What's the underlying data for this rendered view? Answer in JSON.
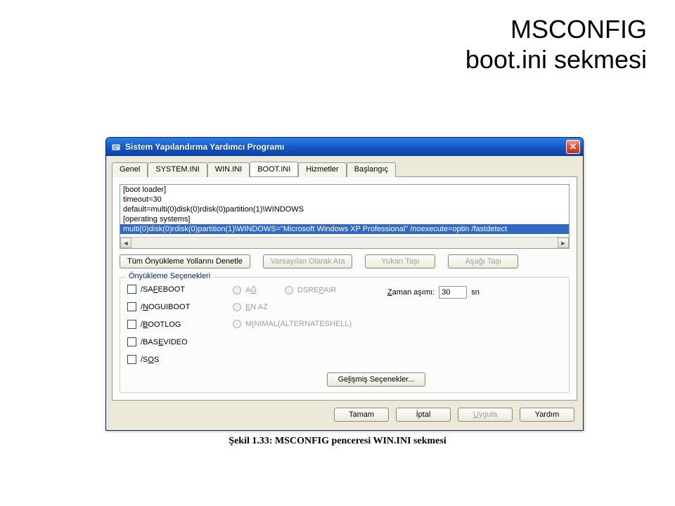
{
  "slide": {
    "title_line1": "MSCONFIG",
    "title_line2": "boot.ini sekmesi"
  },
  "window": {
    "title": "Sistem Yapılandırma Yardımcı Programı"
  },
  "tabs": {
    "items": [
      {
        "label": "Genel"
      },
      {
        "label": "SYSTEM.INI"
      },
      {
        "label": "WIN.INI"
      },
      {
        "label": "BOOT.INI"
      },
      {
        "label": "Hizmetler"
      },
      {
        "label": "Başlangıç"
      }
    ],
    "active_index": 3
  },
  "bootini": {
    "lines": [
      "[boot loader]",
      "timeout=30",
      "default=multi(0)disk(0)rdisk(0)partition(1)\\WINDOWS",
      "[operating systems]",
      "multi(0)disk(0)rdisk(0)partition(1)\\WINDOWS=\"Microsoft Windows XP Professional\" /noexecute=optin /fastdetect"
    ],
    "selected_index": 4
  },
  "buttons": {
    "check_paths": "Tüm Önyükleme Yollarını Denetle",
    "set_default": "Varsayılan Olarak Ata",
    "move_up": "Yukarı Taşı",
    "move_down": "Aşağı Taşı",
    "advanced": "Gelişmiş Seçenekler..."
  },
  "group": {
    "legend": "Önyükleme Seçenekleri",
    "checks": {
      "safeboot": "/SAFEBOOT",
      "noguiboot": "/NOGUIBOOT",
      "bootlog": "/BOOTLOG",
      "basevideo": "/BASEVIDEO",
      "sos": "/SOS"
    },
    "radios": {
      "network": "AĞ",
      "dsrepair": "DSREPAIR",
      "minimal": "EN AZ",
      "altshell": "MINIMAL(ALTERNATESHELL)"
    },
    "timeout_label": "Zaman aşımı:",
    "timeout_value": "30",
    "timeout_unit": "sn"
  },
  "dialog_buttons": {
    "ok": "Tamam",
    "cancel": "İptal",
    "apply": "Uygula",
    "help": "Yardım"
  },
  "caption": "Şekil 1.33: MSCONFIG penceresi WIN.INI sekmesi"
}
